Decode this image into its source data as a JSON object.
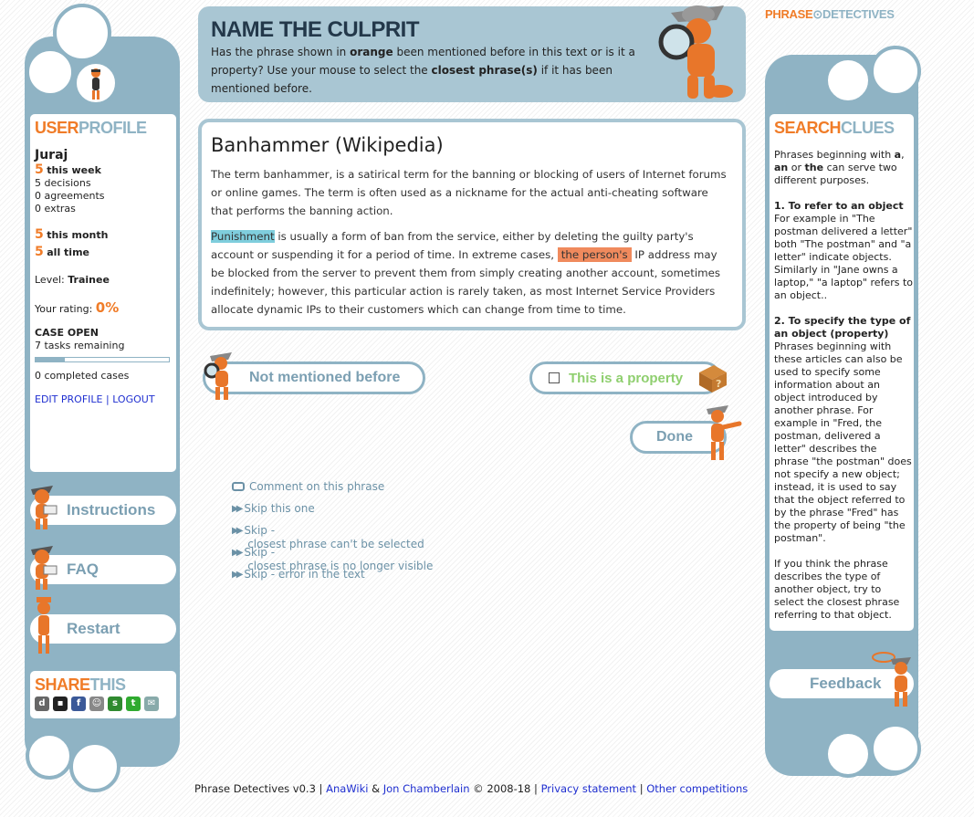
{
  "logo": {
    "part1": "PHRASE",
    "part2": "DETECTIVES"
  },
  "header": {
    "title": "NAME THE CULPRIT",
    "line_pre": "Has the phrase shown in ",
    "line_orange": "orange",
    "line_mid": " been mentioned before in this text or is it a property? Use your mouse to select the ",
    "line_bold": "closest phrase(s)",
    "line_post": " if it has been mentioned before."
  },
  "profile": {
    "heading_a": "USER",
    "heading_b": "PROFILE",
    "username": "Juraj",
    "week_num": "5",
    "week_label": "this week",
    "decisions": "5 decisions",
    "agreements": "0 agreements",
    "extras": "0 extras",
    "month_num": "5",
    "month_label": "this month",
    "all_num": "5",
    "all_label": "all time",
    "level_label": "Level: ",
    "level_value": "Trainee",
    "rating_label": "Your rating: ",
    "rating_value": "0%",
    "case_title": "CASE OPEN",
    "tasks_remaining": "7 tasks remaining",
    "case_progress": 0.22,
    "completed": "0 completed cases",
    "edit_link": "EDIT PROFILE",
    "separator": "|",
    "logout_link": "LOGOUT"
  },
  "left_nav": {
    "instructions": "Instructions",
    "faq": "FAQ",
    "restart": "Restart"
  },
  "share": {
    "heading_a": "SHARE",
    "heading_b": "THIS",
    "icons": [
      "digg-icon",
      "delicious-icon",
      "facebook-icon",
      "reddit-icon",
      "stumbleupon-icon",
      "technorati-icon",
      "email-icon"
    ]
  },
  "article": {
    "title": "Banhammer (Wikipedia)",
    "p1": "The term banhammer, is a satirical term for the banning or blocking of users of Internet forums or online games. The term is often used as a nickname for the actual anti-cheating software that performs the banning action.",
    "p2_hl1": "Punishment",
    "p2_a": " is usually a form of ban from the service, either by deleting the guilty party's account or suspending it for a period of time. In extreme cases, ",
    "p2_hl2": "the person's",
    "p2_b": " IP address may be blocked from the server to prevent them from simply creating another account, sometimes indefinitely; however, this particular action is rarely taken, as most Internet Service Providers allocate dynamic IPs to their customers which can change from time to time."
  },
  "actions": {
    "not_mentioned": "Not mentioned before",
    "property": "This is a property",
    "done": "Done",
    "comment": "Comment on this phrase",
    "skip_one": "Skip this one",
    "skip_cant_select": "Skip -\n closest phrase can't be selected",
    "skip_not_visible": "Skip -\n closest phrase is no longer visible",
    "skip_error": "Skip - error in the text"
  },
  "clues": {
    "heading_a": "SEARCH",
    "heading_b": "CLUES",
    "intro_a": "Phrases beginning with ",
    "intro_b1": "a",
    "intro_c": ", ",
    "intro_b2": "an",
    "intro_d": " or ",
    "intro_b3": "the",
    "intro_e": " can serve two different purposes.",
    "h1": "1. To refer to an object",
    "t1": "For example in \"The postman delivered a letter\" both \"The postman\" and \"a letter\" indicate objects. Similarly in \"Jane owns a laptop,\" \"a laptop\" refers to an object..",
    "h2": "2. To specify the type of an object (property)",
    "t2": "Phrases beginning with these articles can also be used to specify some information about an object introduced by another phrase. For example in \"Fred, the postman, delivered a letter\" describes the phrase \"the postman\" does not specify a new object; instead, it is used to say that the object referred to by the phrase \"Fred\" has the property of being \"the postman\".",
    "t3": "If you think the phrase describes the type of another object, try to select the closest phrase referring to that object."
  },
  "feedback": "Feedback",
  "footer": {
    "version": "Phrase Detectives v0.3 | ",
    "anawiki": "AnaWiki",
    "amp": " & ",
    "jon": "Jon Chamberlain",
    "copy": " © 2008-18 | ",
    "privacy": "Privacy statement",
    "sep": " | ",
    "other": "Other competitions"
  },
  "colors": {
    "accent_orange": "#f07c28",
    "frame_blue": "#8fb3c4",
    "header_bg": "#a9c6d3",
    "property_green": "#8fcf6f",
    "link_blue": "#1f2fd0"
  }
}
